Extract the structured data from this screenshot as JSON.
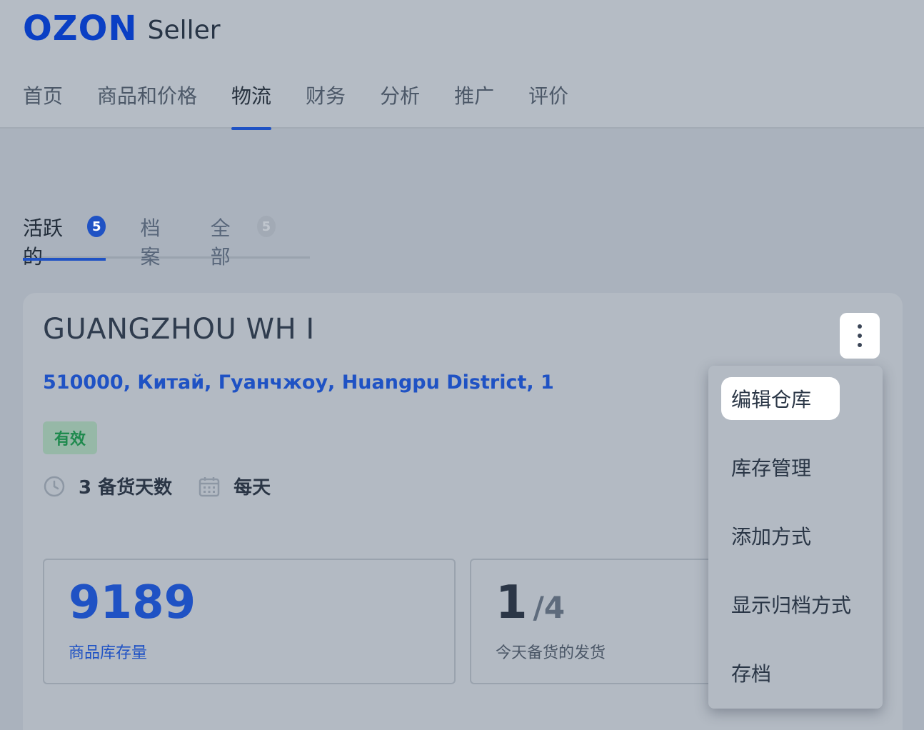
{
  "header": {
    "logo": "OZON",
    "logo_sub": "Seller",
    "nav": [
      "首页",
      "商品和价格",
      "物流",
      "财务",
      "分析",
      "推广",
      "评价"
    ],
    "active_nav_index": 2
  },
  "subtabs": [
    {
      "label": "活跃的",
      "count": "5"
    },
    {
      "label": "档案",
      "count": null
    },
    {
      "label": "全部",
      "count": "5"
    }
  ],
  "warehouse": {
    "name": "GUANGZHOU WH I",
    "address": "510000, Китай, Гуанчжоу, Huangpu District, 1",
    "status": "有效",
    "prep_days": "3 备货天数",
    "schedule": "每天",
    "stock_value": "9189",
    "stock_label": "商品库存量",
    "shipments_value": "1",
    "shipments_total": "/4",
    "shipments_label": "今天备货的发货"
  },
  "menu": {
    "items": [
      "编辑仓库",
      "库存管理",
      "添加方式",
      "显示归档方式",
      "存档"
    ],
    "highlighted_index": 0
  },
  "colors": {
    "accent": "#1f52c4",
    "status_green": "#1f8a4e"
  },
  "icons": [
    "clock-icon",
    "calendar-icon",
    "more-vertical-icon"
  ]
}
